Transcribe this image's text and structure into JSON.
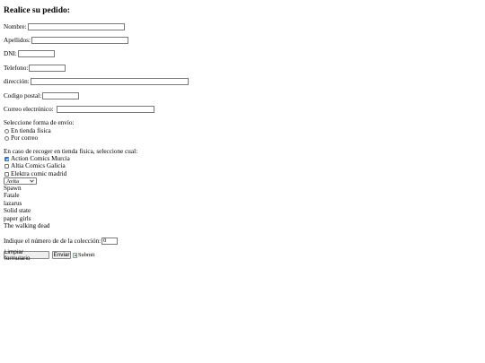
{
  "form": {
    "title": "Realice su pedido:",
    "fields": {
      "nombre": "Nombre:",
      "apellidos": "Apellidos:",
      "dni": "DNI:",
      "telefono": "Telefono:",
      "direccion": "dirección:",
      "codigo_postal": "Codigo postal:",
      "correo": "Correo electrónico:"
    },
    "shipping": {
      "label": "Seleccione forma de envío:",
      "options": [
        "En tienda fisica",
        "Por correo"
      ]
    },
    "stores": {
      "label": "En caso de recoger en tienda fisica, seleccione cual:",
      "options": [
        "Action Comics Murcia",
        "Altia Comics Galicia",
        "Elektra comic madrid"
      ],
      "checked": [
        true,
        false,
        false
      ]
    },
    "select": {
      "value": "Avita"
    },
    "comics": [
      "Spawn",
      "Fatale",
      "lazarus",
      "Solid state",
      "paper girls",
      "The walking dead"
    ],
    "quantity": {
      "label": "Indique el número de de la colección:",
      "value": "0"
    },
    "buttons": {
      "reset": "Limpiar formulario",
      "send": "Enviar",
      "image_submit_alt": "Submit"
    }
  },
  "colors": {
    "accent": "#1a73e8"
  }
}
